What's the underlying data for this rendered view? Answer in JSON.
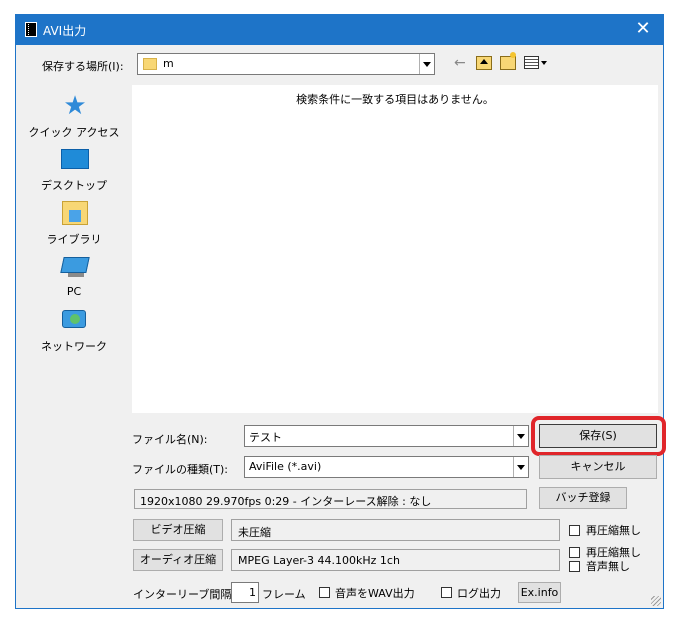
{
  "window": {
    "title": "AVI出力",
    "close_glyph": "✕"
  },
  "location": {
    "label": "保存する場所(I):",
    "value": "m"
  },
  "places": [
    {
      "name": "quick-access",
      "label": "クイック アクセス"
    },
    {
      "name": "desktop",
      "label": "デスクトップ"
    },
    {
      "name": "libraries",
      "label": "ライブラリ"
    },
    {
      "name": "pc",
      "label": "PC"
    },
    {
      "name": "network",
      "label": "ネットワーク"
    }
  ],
  "file_list": {
    "empty_message": "検索条件に一致する項目はありません。"
  },
  "filename": {
    "label": "ファイル名(N):",
    "value": "テスト"
  },
  "filetype": {
    "label": "ファイルの種類(T):",
    "value": "AviFile (*.avi)"
  },
  "buttons": {
    "save": "保存(S)",
    "cancel": "キャンセル",
    "batch": "バッチ登録",
    "video": "ビデオ圧縮",
    "audio": "オーディオ圧縮",
    "exinfo": "Ex.info"
  },
  "info": {
    "summary": "1920x1080  29.970fps  0:29  -  インターレース解除 : なし"
  },
  "video": {
    "codec": "未圧縮",
    "recompress_label": "再圧縮無し"
  },
  "audio": {
    "codec": "MPEG Layer-3 44.100kHz 1ch",
    "recompress_label": "再圧縮無し",
    "no_audio_label": "音声無し"
  },
  "interleave": {
    "label": "インターリーブ間隔 :",
    "value": "1",
    "unit": "フレーム"
  },
  "options": {
    "wav_label": "音声をWAV出力",
    "log_label": "ログ出力"
  },
  "colors": {
    "titlebar": "#1e74c8",
    "highlight": "#e0252a"
  }
}
